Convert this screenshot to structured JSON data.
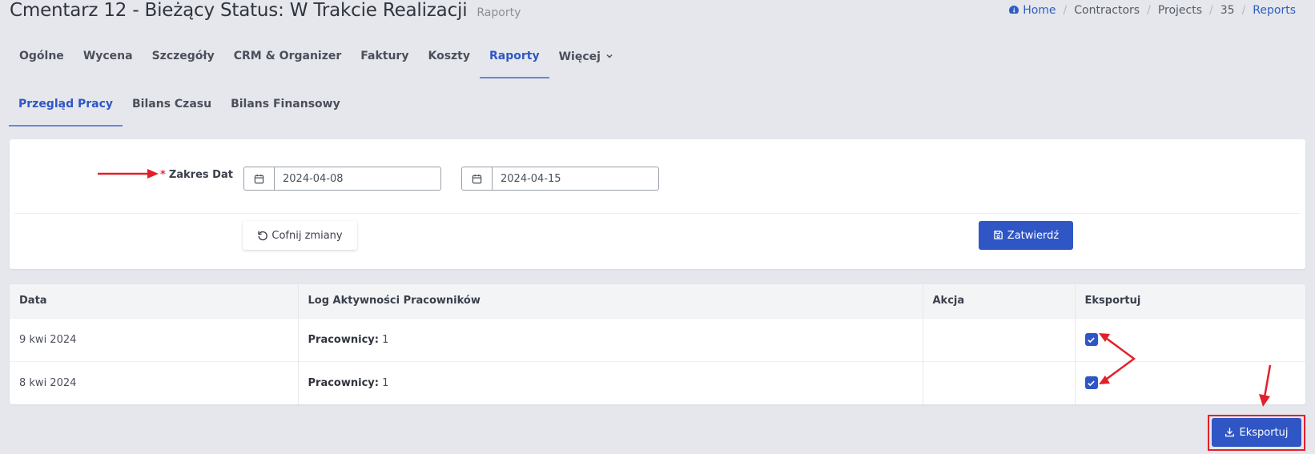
{
  "header": {
    "title": "Cmentarz 12 - Bieżący Status: W Trakcie Realizacji",
    "subtitle": "Raporty"
  },
  "breadcrumb": {
    "items": [
      {
        "label": "Home",
        "icon": "dashboard-icon"
      },
      {
        "label": "Contractors"
      },
      {
        "label": "Projects"
      },
      {
        "label": "35"
      },
      {
        "label": "Reports"
      }
    ]
  },
  "main_tabs": [
    {
      "label": "Ogólne"
    },
    {
      "label": "Wycena"
    },
    {
      "label": "Szczegóły"
    },
    {
      "label": "CRM & Organizer"
    },
    {
      "label": "Faktury"
    },
    {
      "label": "Koszty"
    },
    {
      "label": "Raporty",
      "active": true
    },
    {
      "label": "Więcej",
      "icon": "chevron-down-icon"
    }
  ],
  "sub_tabs": [
    {
      "label": "Przegląd Pracy",
      "active": true
    },
    {
      "label": "Bilans Czasu"
    },
    {
      "label": "Bilans Finansowy"
    }
  ],
  "filter": {
    "required_mark": "*",
    "date_range_label": "Zakres Dat",
    "date_from": "2024-04-08",
    "date_to": "2024-04-15",
    "reset_label": "Cofnij zmiany",
    "submit_label": "Zatwierdź"
  },
  "table": {
    "columns": [
      "Data",
      "Log Aktywności Pracowników",
      "Akcja",
      "Eksportuj"
    ],
    "rows": [
      {
        "date": "9 kwi 2024",
        "log_label": "Pracownicy:",
        "log_value": "1",
        "action": "",
        "export_checked": true
      },
      {
        "date": "8 kwi 2024",
        "log_label": "Pracownicy:",
        "log_value": "1",
        "action": "",
        "export_checked": true
      }
    ]
  },
  "export": {
    "label": "Eksportuj"
  },
  "colors": {
    "accent": "#2f56c4",
    "annotation_red": "#e3202a"
  }
}
